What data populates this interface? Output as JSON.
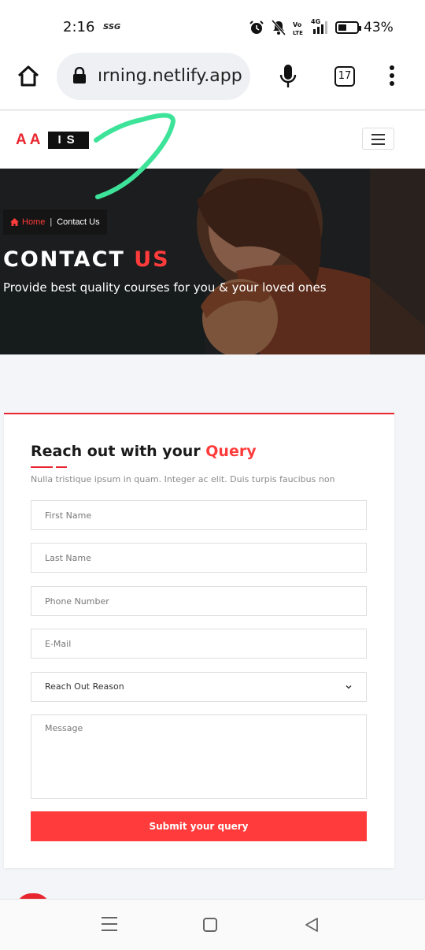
{
  "status_bar": {
    "time": "2:16",
    "carrier_tag": "SSG",
    "network_label": "4G",
    "battery_percent": "43%"
  },
  "browser": {
    "url": "ırning.netlify.app",
    "tab_count": "17"
  },
  "site": {
    "logo_left": "AA",
    "logo_right": "IS"
  },
  "hero": {
    "breadcrumb_home": "Home",
    "breadcrumb_current": "Contact Us",
    "title_main": "CONTACT",
    "title_accent": "US",
    "subtitle": "Provide best quality courses for you & your loved ones"
  },
  "form": {
    "title_main": "Reach out with your",
    "title_accent": "Query",
    "description": "Nulla tristique ipsum in quam. Integer ac elit. Duis turpis faucibus non",
    "first_name_placeholder": "First Name",
    "last_name_placeholder": "Last Name",
    "phone_placeholder": "Phone Number",
    "email_placeholder": "E-Mail",
    "reason_selected": "Reach Out Reason",
    "message_placeholder": "Message",
    "submit_label": "Submit your query"
  },
  "colors": {
    "accent": "#ff3b3b",
    "brand_red": "#e8262f",
    "annotation_green": "#3ee39a"
  },
  "icons": {
    "home": "home-icon",
    "lock": "lock-icon",
    "mic": "microphone-icon",
    "menu": "more-vert-icon",
    "hamburger": "hamburger-icon",
    "chevron": "chevron-down-icon"
  }
}
